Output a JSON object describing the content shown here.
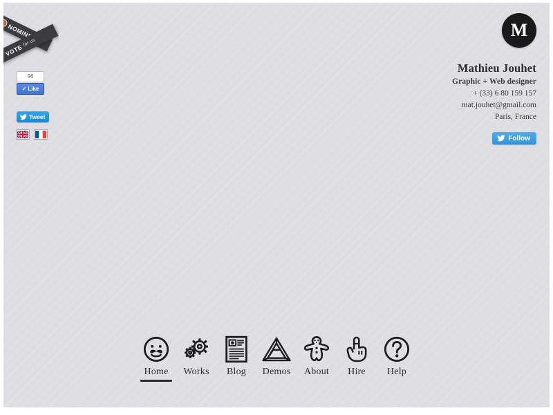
{
  "page": {
    "background_color": "#dedde2",
    "border_color": "#ffffff"
  },
  "ribbon": {
    "name": "nominee-vote-ribbon",
    "top_label": "NOMINEE",
    "bottom_label": "VOTE",
    "bottom_sub_label": "for us",
    "badge_color": "#b4633a",
    "band_color": "#3c3c40"
  },
  "social": {
    "facebook": {
      "count": "96",
      "like_label": "Like",
      "check_glyph": "✓",
      "button_color": "#4a7fe0"
    },
    "twitter_tweet": {
      "label": "Tweet",
      "button_color": "#1b95e0"
    },
    "twitter_follow": {
      "label": "Follow",
      "button_color": "#3fa0e4"
    }
  },
  "languages": [
    {
      "code": "en",
      "name": "flag-united-kingdom"
    },
    {
      "code": "fr",
      "name": "flag-france"
    }
  ],
  "identity": {
    "logo_letter": "M",
    "name": "Mathieu Jouhet",
    "role": "Graphic + Web designer",
    "phone": "+ (33) 6 80 159 157",
    "email": "mat.jouhet@gmail.com",
    "location": "Paris, France"
  },
  "nav": {
    "active": "Home",
    "items": [
      {
        "label": "Home",
        "icon": "mustache-face-icon",
        "active": true
      },
      {
        "label": "Works",
        "icon": "gears-icon",
        "active": false
      },
      {
        "label": "Blog",
        "icon": "document-article-icon",
        "active": false
      },
      {
        "label": "Demos",
        "icon": "penrose-triangle-icon",
        "active": false
      },
      {
        "label": "About",
        "icon": "gingerbread-man-icon",
        "active": false
      },
      {
        "label": "Hire",
        "icon": "pointing-hand-icon",
        "active": false
      },
      {
        "label": "Help",
        "icon": "question-mark-circle-icon",
        "active": false
      }
    ]
  }
}
